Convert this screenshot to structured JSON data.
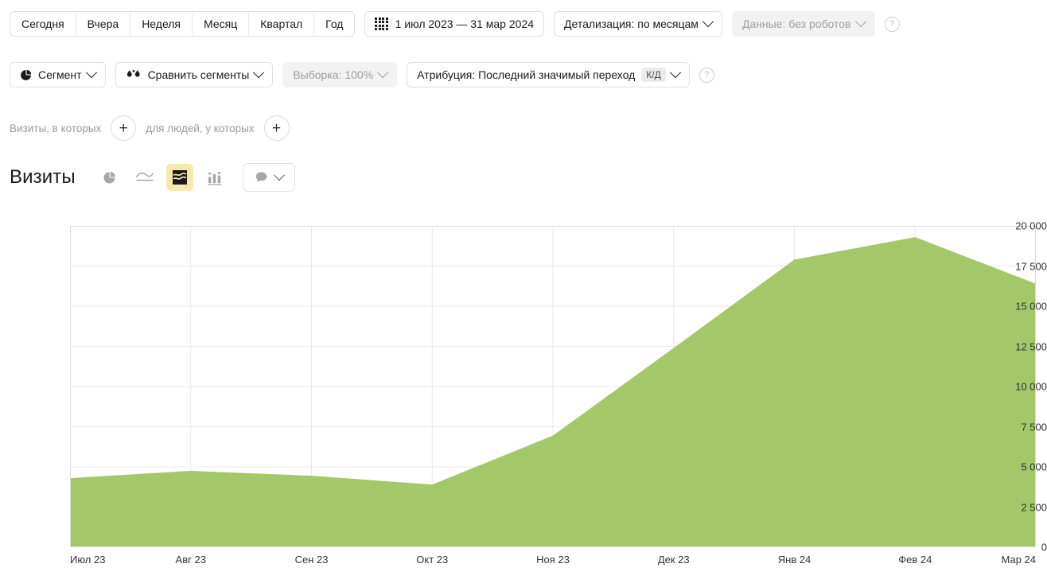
{
  "toolbar": {
    "periods": [
      {
        "label": "Сегодня",
        "name": "period-today"
      },
      {
        "label": "Вчера",
        "name": "period-yesterday"
      },
      {
        "label": "Неделя",
        "name": "period-week"
      },
      {
        "label": "Месяц",
        "name": "period-month"
      },
      {
        "label": "Квартал",
        "name": "period-quarter"
      },
      {
        "label": "Год",
        "name": "period-year"
      }
    ],
    "date_range": "1 июл 2023 — 31 мар 2024",
    "detail": "Детализация: по месяцам",
    "data_source": "Данные: без роботов",
    "help": "?"
  },
  "segments": {
    "segment": "Сегмент",
    "compare": "Сравнить сегменты",
    "sample": "Выборка: 100%",
    "attribution": "Атрибуция: Последний значимый переход",
    "attribution_badge": "К/Д",
    "help": "?"
  },
  "filters": {
    "visits_label": "Визиты, в которых",
    "people_label": "для людей, у которых",
    "add": "+"
  },
  "chart_header": {
    "title": "Визиты",
    "views": [
      {
        "name": "chart-type-pie-icon",
        "active": false
      },
      {
        "name": "chart-type-line-icon",
        "active": false
      },
      {
        "name": "chart-type-area-icon",
        "active": true
      },
      {
        "name": "chart-type-bar-icon",
        "active": false
      }
    ]
  },
  "chart_data": {
    "type": "area",
    "title": "Визиты",
    "xlabel": "",
    "ylabel": "",
    "categories": [
      "Июл 23",
      "Авг 23",
      "Сен 23",
      "Окт 23",
      "Ноя 23",
      "Дек 23",
      "Янв 24",
      "Фев 24",
      "Мар 24"
    ],
    "values": [
      4300,
      4750,
      4450,
      3900,
      6950,
      12400,
      17900,
      19300,
      16400
    ],
    "series": [
      {
        "name": "Визиты",
        "color": "#A4C76A",
        "values": [
          4300,
          4750,
          4450,
          3900,
          6950,
          12400,
          17900,
          19300,
          16400
        ]
      }
    ],
    "ylim": [
      0,
      20000
    ],
    "yticks": [
      0,
      2500,
      5000,
      7500,
      10000,
      12500,
      15000,
      17500,
      20000
    ],
    "ytick_labels": [
      "0",
      "2 500",
      "5 000",
      "7 500",
      "10 000",
      "12 500",
      "15 000",
      "17 500",
      "20 000"
    ],
    "grid": true,
    "legend": "none",
    "fill_color": "#A4C76A",
    "grid_color": "#e9e9e9"
  }
}
